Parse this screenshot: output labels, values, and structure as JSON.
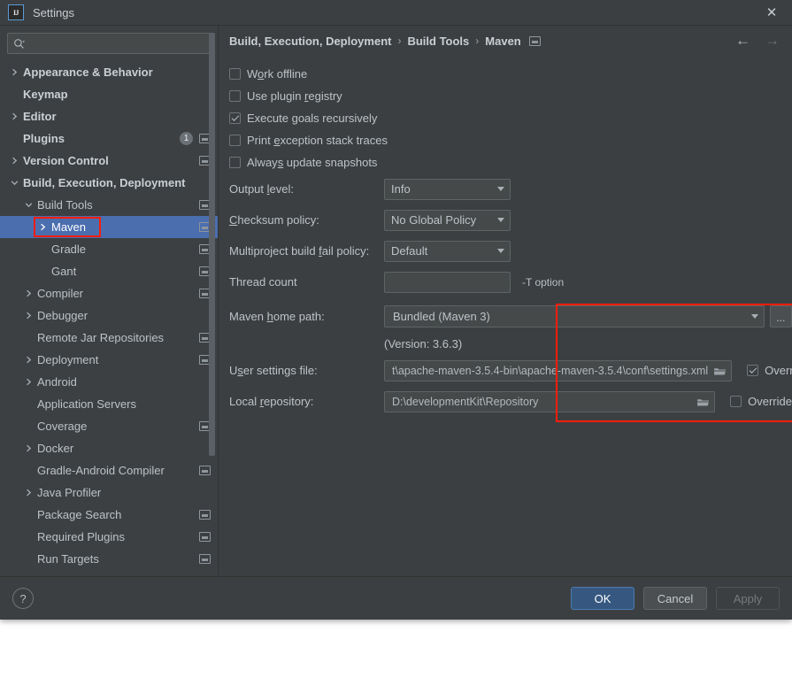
{
  "window": {
    "title": "Settings",
    "logo_text": "IJ",
    "close_icon": "close-icon"
  },
  "sidebar": {
    "search": {
      "placeholder": "",
      "value": "",
      "icon": "search-icon"
    },
    "items": [
      {
        "label": "Appearance & Behavior",
        "indent": 0,
        "arrow": "right",
        "bold": true,
        "scope": false,
        "badge": null,
        "selected": false
      },
      {
        "label": "Keymap",
        "indent": 0,
        "arrow": "none",
        "bold": true,
        "scope": false,
        "badge": null,
        "selected": false
      },
      {
        "label": "Editor",
        "indent": 0,
        "arrow": "right",
        "bold": true,
        "scope": false,
        "badge": null,
        "selected": false
      },
      {
        "label": "Plugins",
        "indent": 0,
        "arrow": "none",
        "bold": true,
        "scope": true,
        "badge": "1",
        "selected": false
      },
      {
        "label": "Version Control",
        "indent": 0,
        "arrow": "right",
        "bold": true,
        "scope": true,
        "badge": null,
        "selected": false
      },
      {
        "label": "Build, Execution, Deployment",
        "indent": 0,
        "arrow": "down",
        "bold": true,
        "scope": false,
        "badge": null,
        "selected": false
      },
      {
        "label": "Build Tools",
        "indent": 1,
        "arrow": "down",
        "bold": false,
        "scope": true,
        "badge": null,
        "selected": false
      },
      {
        "label": "Maven",
        "indent": 2,
        "arrow": "right",
        "bold": false,
        "scope": true,
        "badge": null,
        "selected": true
      },
      {
        "label": "Gradle",
        "indent": 2,
        "arrow": "none",
        "bold": false,
        "scope": true,
        "badge": null,
        "selected": false
      },
      {
        "label": "Gant",
        "indent": 2,
        "arrow": "none",
        "bold": false,
        "scope": true,
        "badge": null,
        "selected": false
      },
      {
        "label": "Compiler",
        "indent": 1,
        "arrow": "right",
        "bold": false,
        "scope": true,
        "badge": null,
        "selected": false
      },
      {
        "label": "Debugger",
        "indent": 1,
        "arrow": "right",
        "bold": false,
        "scope": false,
        "badge": null,
        "selected": false
      },
      {
        "label": "Remote Jar Repositories",
        "indent": 1,
        "arrow": "none",
        "bold": false,
        "scope": true,
        "badge": null,
        "selected": false
      },
      {
        "label": "Deployment",
        "indent": 1,
        "arrow": "right",
        "bold": false,
        "scope": true,
        "badge": null,
        "selected": false
      },
      {
        "label": "Android",
        "indent": 1,
        "arrow": "right",
        "bold": false,
        "scope": false,
        "badge": null,
        "selected": false
      },
      {
        "label": "Application Servers",
        "indent": 1,
        "arrow": "none",
        "bold": false,
        "scope": false,
        "badge": null,
        "selected": false
      },
      {
        "label": "Coverage",
        "indent": 1,
        "arrow": "none",
        "bold": false,
        "scope": true,
        "badge": null,
        "selected": false
      },
      {
        "label": "Docker",
        "indent": 1,
        "arrow": "right",
        "bold": false,
        "scope": false,
        "badge": null,
        "selected": false
      },
      {
        "label": "Gradle-Android Compiler",
        "indent": 1,
        "arrow": "none",
        "bold": false,
        "scope": true,
        "badge": null,
        "selected": false
      },
      {
        "label": "Java Profiler",
        "indent": 1,
        "arrow": "right",
        "bold": false,
        "scope": false,
        "badge": null,
        "selected": false
      },
      {
        "label": "Package Search",
        "indent": 1,
        "arrow": "none",
        "bold": false,
        "scope": true,
        "badge": null,
        "selected": false
      },
      {
        "label": "Required Plugins",
        "indent": 1,
        "arrow": "none",
        "bold": false,
        "scope": true,
        "badge": null,
        "selected": false
      },
      {
        "label": "Run Targets",
        "indent": 1,
        "arrow": "none",
        "bold": false,
        "scope": true,
        "badge": null,
        "selected": false
      }
    ]
  },
  "breadcrumb": {
    "items": [
      "Build, Execution, Deployment",
      "Build Tools",
      "Maven"
    ],
    "separator": "›",
    "back_icon": "arrow-left-icon",
    "forward_icon": "arrow-right-icon"
  },
  "main": {
    "checkboxes": [
      {
        "label": "Work offline",
        "mnemonic": "o",
        "checked": false
      },
      {
        "label": "Use plugin registry",
        "mnemonic": "r",
        "checked": false
      },
      {
        "label": "Execute goals recursively",
        "mnemonic": "g",
        "checked": true
      },
      {
        "label": "Print exception stack traces",
        "mnemonic": "e",
        "checked": false
      },
      {
        "label": "Always update snapshots",
        "mnemonic": "s",
        "checked": false
      }
    ],
    "output_level": {
      "label": "Output level:",
      "mnemonic": "l",
      "value": "Info"
    },
    "checksum_policy": {
      "label": "Checksum policy:",
      "mnemonic": "C",
      "value": "No Global Policy"
    },
    "fail_policy": {
      "label": "Multiproject build fail policy:",
      "mnemonic": "f",
      "value": "Default"
    },
    "thread_count": {
      "label": "Thread count",
      "value": "",
      "hint": "-T option"
    },
    "maven_home": {
      "label": "Maven home path:",
      "mnemonic": "h",
      "value": "Bundled (Maven 3)",
      "browse_label": "..."
    },
    "maven_version": "(Version: 3.6.3)",
    "user_settings": {
      "label": "User settings file:",
      "mnemonic": "s",
      "value": "t\\apache-maven-3.5.4-bin\\apache-maven-3.5.4\\conf\\settings.xml",
      "override_label": "Override",
      "override_checked": true
    },
    "local_repo": {
      "label": "Local repository:",
      "mnemonic": "r",
      "value": "D:\\developmentKit\\Repository",
      "override_label": "Override",
      "override_checked": false
    },
    "highlight_color": "#fc1d0b"
  },
  "footer": {
    "help_label": "?",
    "ok_label": "OK",
    "cancel_label": "Cancel",
    "apply_label": "Apply"
  }
}
